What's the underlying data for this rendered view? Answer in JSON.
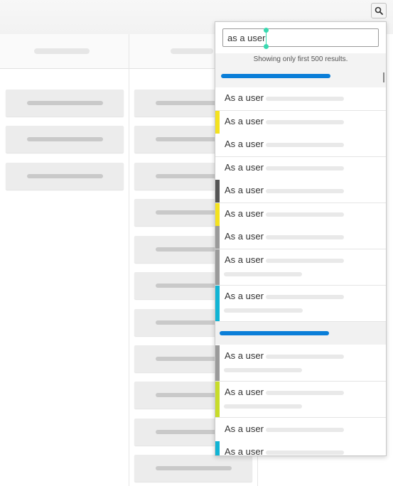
{
  "search": {
    "value": "as a user",
    "info": "Showing only first 500 results."
  },
  "results": [
    {
      "label": "As a user",
      "stripe": "",
      "tall": false
    },
    {
      "label": "As a user",
      "stripe": "#f4e21f",
      "tall": false
    },
    {
      "label": "As a user",
      "stripe": "",
      "tall": false
    },
    {
      "label": "As a user",
      "stripe": "",
      "tall": false
    },
    {
      "label": "As a user",
      "stripe": "#555555",
      "tall": false
    },
    {
      "label": "As a user",
      "stripe": "#f4e21f",
      "tall": false
    },
    {
      "label": "As a user",
      "stripe": "#9a9a9a",
      "tall": false
    },
    {
      "label": "As a user",
      "stripe": "#9a9a9a",
      "tall": true
    },
    {
      "label": "As a user",
      "stripe": "#11b4d4",
      "tall": true
    },
    {
      "label": "As a user",
      "stripe": "#9a9a9a",
      "tall": true
    },
    {
      "label": "As a user",
      "stripe": "#c8dc2a",
      "tall": true
    },
    {
      "label": "As a user",
      "stripe": "",
      "tall": false
    },
    {
      "label": "As a user",
      "stripe": "#11b4d4",
      "tall": false
    }
  ],
  "colors": {
    "accent": "#0a7ed8",
    "caret": "#38d9b0"
  }
}
